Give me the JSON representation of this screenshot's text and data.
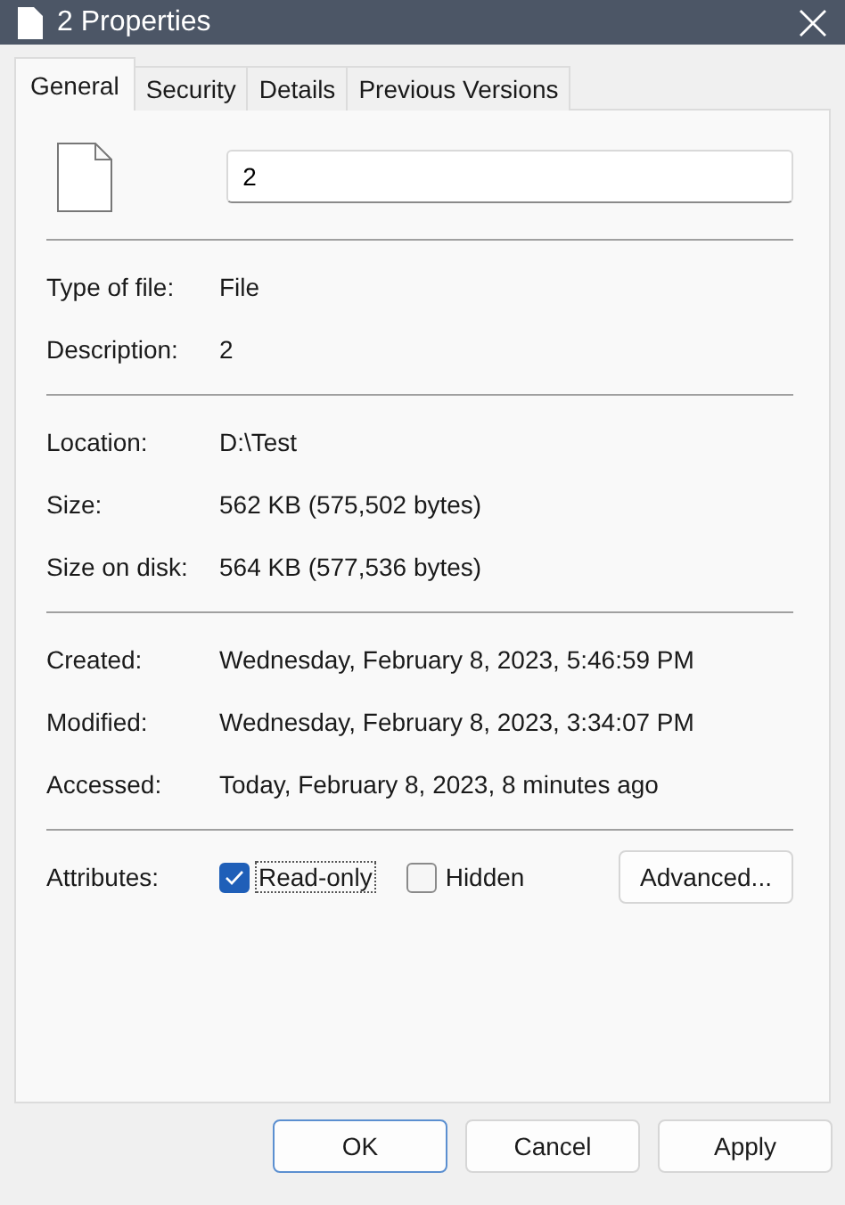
{
  "window": {
    "title": "2 Properties"
  },
  "tabs": [
    {
      "label": "General",
      "selected": true
    },
    {
      "label": "Security",
      "selected": false
    },
    {
      "label": "Details",
      "selected": false
    },
    {
      "label": "Previous Versions",
      "selected": false
    }
  ],
  "name_field": {
    "value": "2"
  },
  "groups": [
    [
      {
        "label": "Type of file:",
        "value": "File"
      },
      {
        "label": "Description:",
        "value": "2"
      }
    ],
    [
      {
        "label": "Location:",
        "value": "D:\\Test"
      },
      {
        "label": "Size:",
        "value": "562 KB (575,502 bytes)"
      },
      {
        "label": "Size on disk:",
        "value": "564 KB (577,536 bytes)"
      }
    ],
    [
      {
        "label": "Created:",
        "value": "Wednesday, February 8, 2023, 5:46:59 PM"
      },
      {
        "label": "Modified:",
        "value": "Wednesday, February 8, 2023, 3:34:07 PM"
      },
      {
        "label": "Accessed:",
        "value": "Today, February 8, 2023, 8 minutes ago"
      }
    ]
  ],
  "attributes": {
    "label": "Attributes:",
    "options": [
      {
        "label": "Read-only",
        "checked": true
      },
      {
        "label": "Hidden",
        "checked": false
      }
    ],
    "advanced_button": "Advanced..."
  },
  "buttons": [
    {
      "label": "OK",
      "selected": true
    },
    {
      "label": "Cancel",
      "selected": false
    },
    {
      "label": "Apply",
      "selected": false
    }
  ]
}
